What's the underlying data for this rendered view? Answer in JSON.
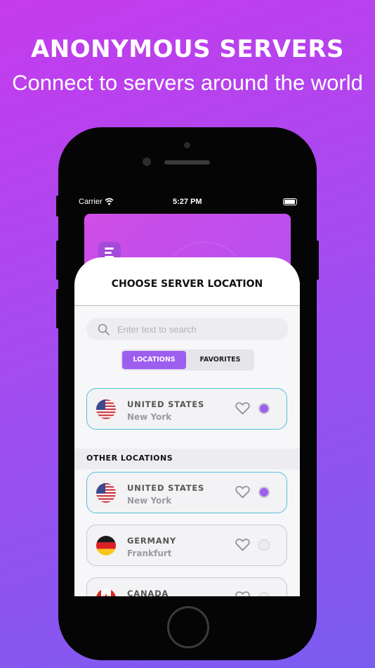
{
  "promo": {
    "headline": "ANONYMOUS SERVERS",
    "subheadline": "Connect to servers around the world"
  },
  "status_bar": {
    "carrier": "Carrier",
    "time": "5:27 PM"
  },
  "sheet": {
    "title": "CHOOSE SERVER LOCATION",
    "search_placeholder": "Enter text to search",
    "tabs": [
      {
        "label": "LOCATIONS",
        "active": true
      },
      {
        "label": "FAVORITES",
        "active": false
      }
    ],
    "current": {
      "country": "UNITED STATES",
      "city": "New York",
      "flag": "us-flag-icon",
      "selected": true
    },
    "section_label": "OTHER LOCATIONS",
    "locations": [
      {
        "country": "UNITED STATES",
        "city": "New York",
        "flag": "us-flag-icon",
        "selected": true
      },
      {
        "country": "GERMANY",
        "city": "Frankfurt",
        "flag": "germany-flag-icon",
        "selected": false
      },
      {
        "country": "CANADA",
        "city": "",
        "flag": "canada-flag-icon",
        "selected": false
      }
    ]
  },
  "colors": {
    "accent": "#9d5ef0",
    "selected_border": "#50c2de",
    "background_top": "#c53bec",
    "background_bottom": "#7a5cf0"
  }
}
